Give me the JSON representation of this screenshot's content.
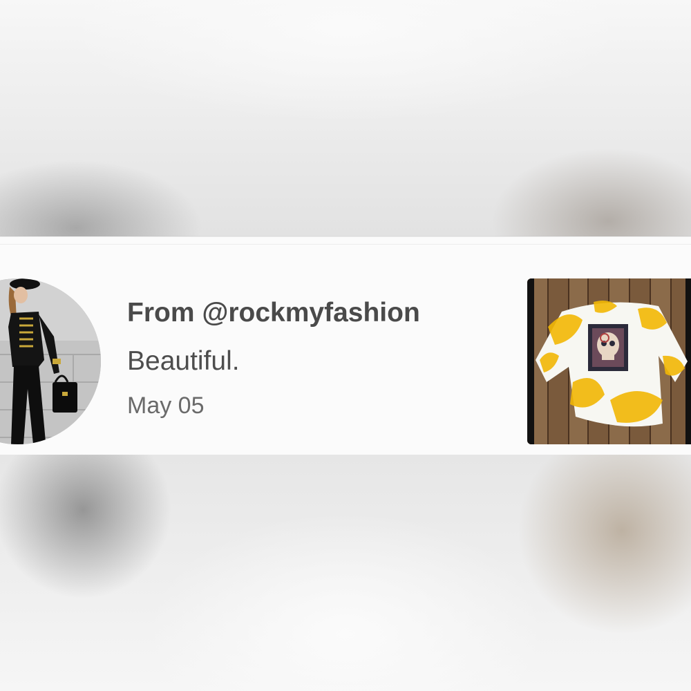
{
  "notification": {
    "from_text": "From @rockmyfashion",
    "message": "Beautiful.",
    "date": "May 05",
    "avatar_icon": "user-avatar",
    "thumbnail_icon": "product-thumbnail"
  },
  "colors": {
    "primary_text": "#4a4a4a",
    "secondary_text": "#6a6a6a",
    "card_background": "#fbfbfb",
    "shirt_accent": "#f2b705"
  }
}
